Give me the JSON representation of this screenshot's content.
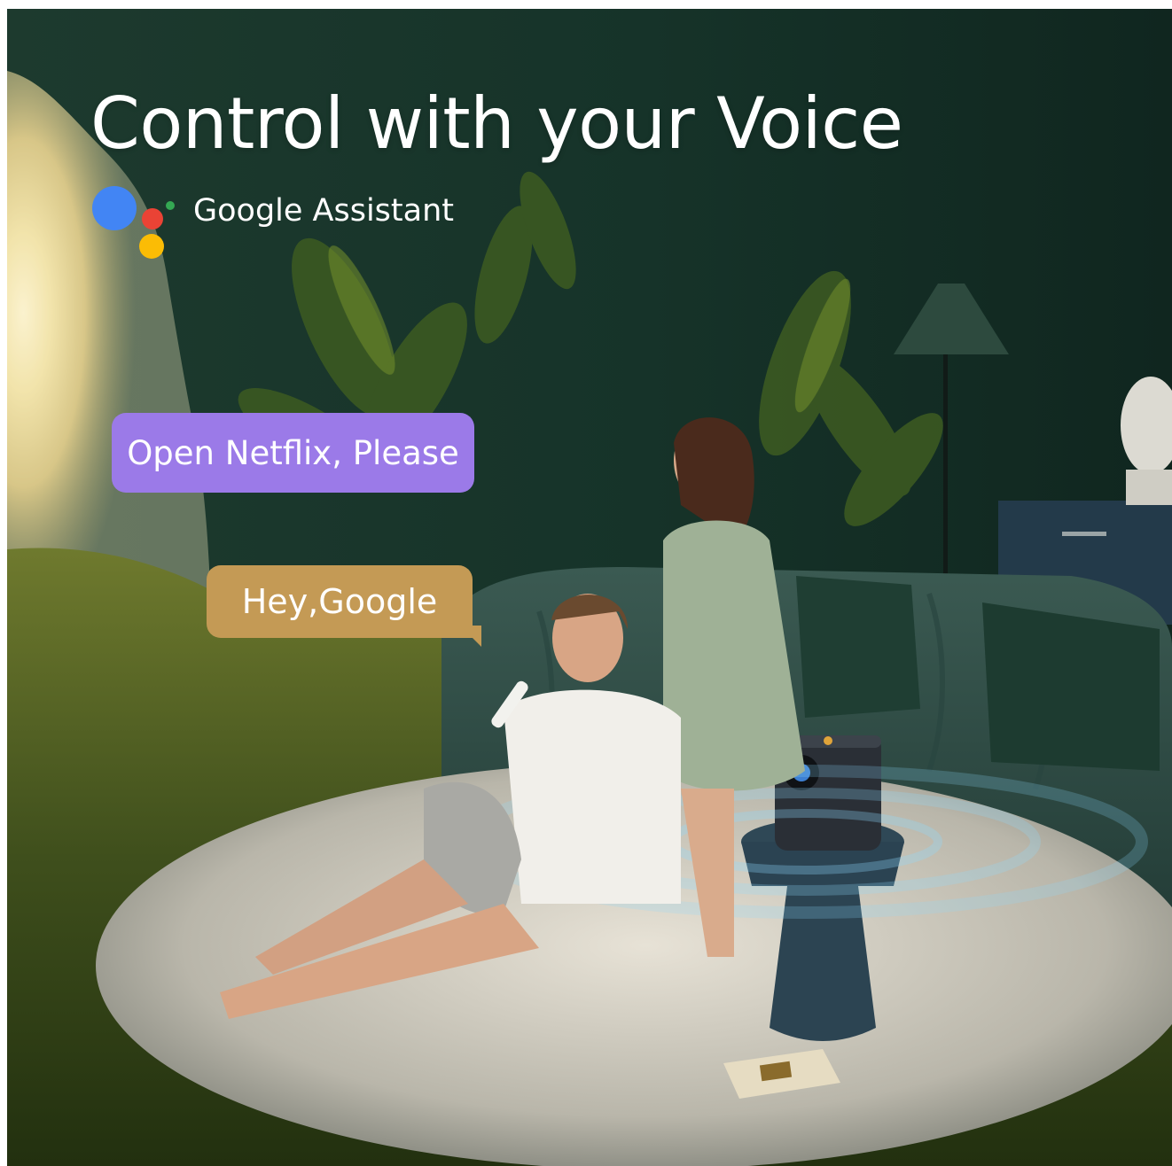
{
  "headline": "Control with your Voice",
  "assistant": {
    "label": "Google Assistant",
    "dot_colors": [
      "#4285F4",
      "#EA4335",
      "#FBBC05",
      "#34A853"
    ]
  },
  "bubbles": {
    "request": "Open Netflix, Please",
    "wake": "Hey,Google"
  },
  "colors": {
    "request_bubble": "#9b7ae8",
    "wake_bubble": "#c49a55",
    "wall": "#1f3a30"
  }
}
